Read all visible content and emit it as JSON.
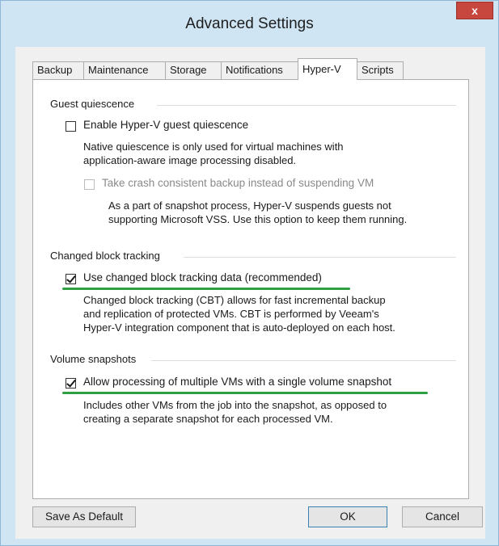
{
  "window": {
    "title": "Advanced Settings",
    "close_label": "x"
  },
  "tabs": [
    "Backup",
    "Maintenance",
    "Storage",
    "Notifications",
    "Hyper-V",
    "Scripts"
  ],
  "active_tab": "Hyper-V",
  "guest_quiescence": {
    "heading": "Guest quiescence",
    "enable_label": "Enable Hyper-V guest quiescence",
    "enable_checked": false,
    "enable_desc": [
      "Native quiescence is only used for virtual machines with",
      "application-aware image processing disabled."
    ],
    "crash_label": "Take crash consistent backup instead of suspending VM",
    "crash_checked": false,
    "crash_enabled": false,
    "crash_desc": [
      "As a part of snapshot process, Hyper-V suspends guests not",
      "supporting Microsoft VSS. Use this option to keep them running."
    ]
  },
  "cbt": {
    "heading": "Changed block tracking",
    "label": "Use changed block tracking data (recommended)",
    "checked": true,
    "desc": [
      "Changed block tracking (CBT) allows for fast incremental backup",
      "and replication of protected VMs. CBT is performed by Veeam's",
      "Hyper-V integration component that is auto-deployed on each host."
    ]
  },
  "volume_snapshots": {
    "heading": "Volume snapshots",
    "label": "Allow processing of multiple VMs with a single volume snapshot",
    "checked": true,
    "desc": [
      "Includes other VMs from the job into the snapshot, as opposed to",
      "creating a separate snapshot for each processed VM."
    ]
  },
  "buttons": {
    "save_default": "Save As Default",
    "ok": "OK",
    "cancel": "Cancel"
  },
  "colors": {
    "highlight_underline": "#2ea043",
    "close_button": "#c7463d"
  }
}
